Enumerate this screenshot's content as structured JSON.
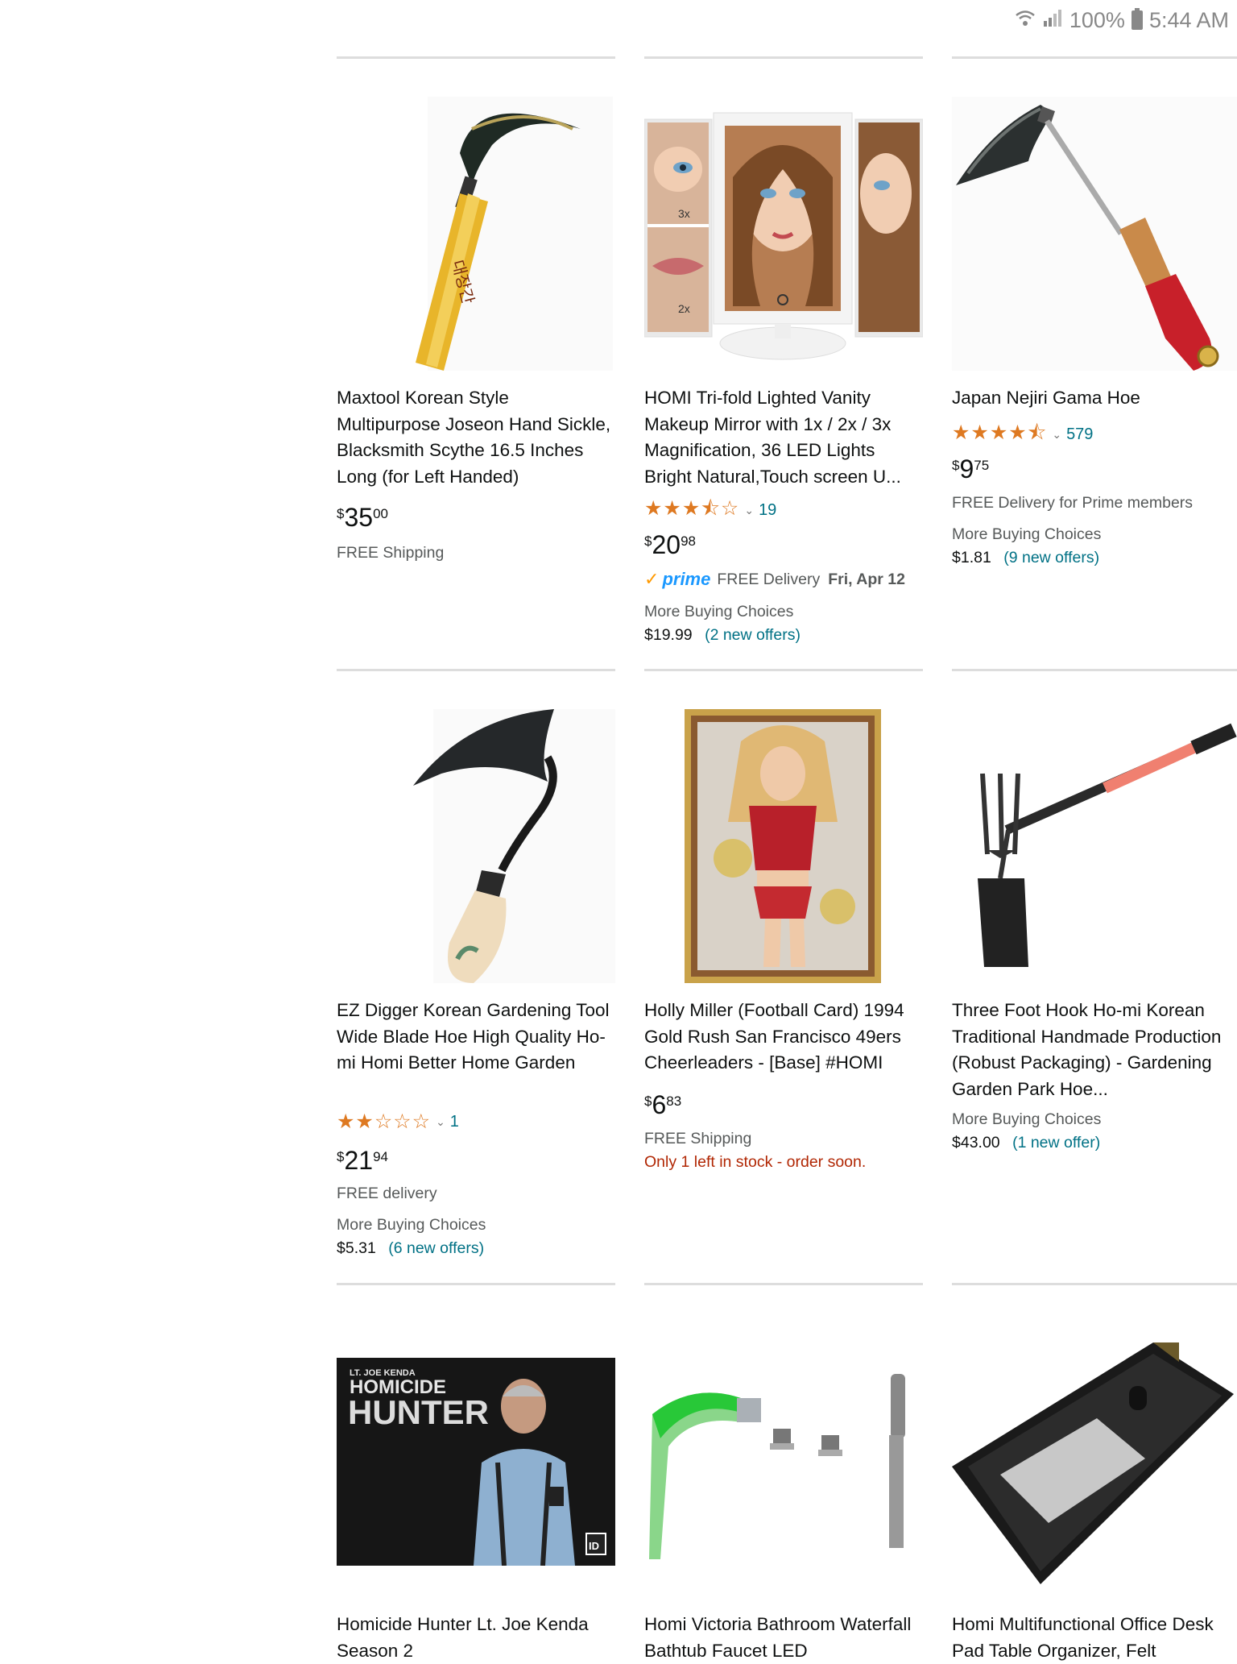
{
  "status": {
    "battery": "100%",
    "time": "5:44 AM"
  },
  "products": [
    {
      "title": "Maxtool Korean Style Multipurpose Joseon Hand Sickle, Blacksmith Scythe 16.5 Inches Long (for Left Handed)",
      "price_whole": "35",
      "price_frac": "00",
      "currency": "$",
      "shipping": "FREE Shipping"
    },
    {
      "title": "HOMI Tri-fold Lighted Vanity Makeup Mirror with 1x / 2x / 3x Magnification, 36 LED Lights Bright Natural,Touch screen U...",
      "rating": 3.5,
      "stars": "★★★⯪☆",
      "reviews": "19",
      "price_whole": "20",
      "price_frac": "98",
      "currency": "$",
      "prime_label": "prime",
      "delivery_text": "FREE Delivery",
      "delivery_date": "Fri, Apr 12",
      "more_choices": "More Buying Choices",
      "alt_price": "$19.99",
      "offers": "(2 new offers)",
      "mirror_labels": [
        "3x",
        "2x"
      ]
    },
    {
      "title": "Japan Nejiri Gama Hoe",
      "rating": 4.5,
      "stars": "★★★★⯪",
      "reviews": "579",
      "price_whole": "9",
      "price_frac": "75",
      "currency": "$",
      "shipping": "FREE Delivery for Prime members",
      "more_choices": "More Buying Choices",
      "alt_price": "$1.81",
      "offers": "(9 new offers)"
    },
    {
      "title": "EZ Digger Korean Gardening Tool Wide Blade Hoe High Quality Ho-mi Homi Better Home Garden",
      "rating": 2,
      "stars": "★★☆☆☆",
      "reviews": "1",
      "price_whole": "21",
      "price_frac": "94",
      "currency": "$",
      "shipping": "FREE delivery",
      "more_choices": "More Buying Choices",
      "alt_price": "$5.31",
      "offers": "(6 new offers)"
    },
    {
      "title": "Holly Miller (Football Card) 1994 Gold Rush San Francisco 49ers Cheerleaders - [Base] #HOMI",
      "price_whole": "6",
      "price_frac": "83",
      "currency": "$",
      "shipping": "FREE Shipping",
      "stock": "Only 1 left in stock - order soon."
    },
    {
      "title": "Three Foot Hook Ho-mi Korean Traditional Handmade Production (Robust Packaging) - Gardening Garden Park Hoe...",
      "more_choices": "More Buying Choices",
      "alt_price": "$43.00",
      "offers": "(1 new offer)"
    },
    {
      "title": "Homicide Hunter Lt. Joe Kenda Season 2",
      "poster_top": "LT. JOE KENDA",
      "poster_line1": "HOMICIDE",
      "poster_line2": "HUNTER",
      "poster_logo": "ID"
    },
    {
      "title": "Homi Victoria Bathroom Waterfall Bathtub Faucet LED"
    },
    {
      "title": "Homi Multifunctional Office Desk Pad Table Organizer, Felt"
    }
  ]
}
